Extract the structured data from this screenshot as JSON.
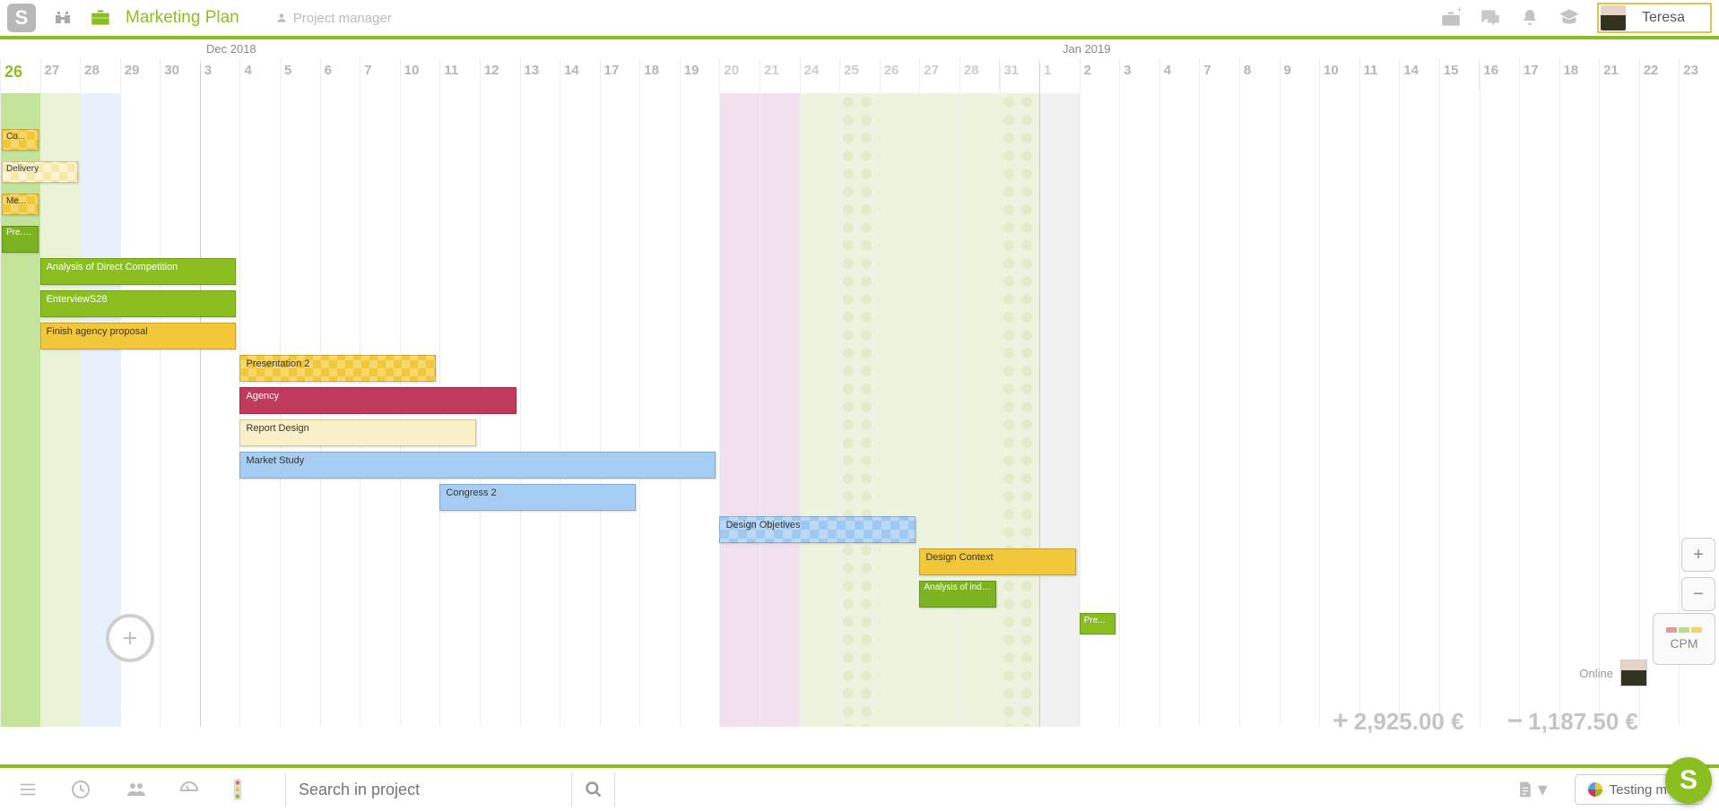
{
  "header": {
    "title": "Marketing Plan",
    "role": "Project manager",
    "user_name": "Teresa"
  },
  "timeline": {
    "month_left": "Dec 2018",
    "month_right": "Jan 2019",
    "days": [
      "26",
      "27",
      "28",
      "29",
      "30",
      "3",
      "4",
      "5",
      "6",
      "7",
      "10",
      "11",
      "12",
      "13",
      "14",
      "17",
      "18",
      "19",
      "20",
      "21",
      "24",
      "25",
      "26",
      "27",
      "28",
      "31",
      "1",
      "2",
      "3",
      "4",
      "7",
      "8",
      "9",
      "10",
      "11",
      "14",
      "15",
      "16",
      "17",
      "18",
      "21",
      "22",
      "23"
    ]
  },
  "tasks": [
    {
      "label": "Co...",
      "row": 0,
      "start": 0,
      "span": 1,
      "cls": "c-yellow-chk small"
    },
    {
      "label": "Delivery",
      "row": 1,
      "start": 0,
      "span": 2,
      "cls": "c-yellow-chk-l small"
    },
    {
      "label": "Me...",
      "row": 2,
      "start": 0,
      "span": 1,
      "cls": "c-yellow-chk small"
    },
    {
      "label": "Pre... for the",
      "row": 3,
      "start": 0,
      "span": 1,
      "cls": "c-green-d multi"
    },
    {
      "label": "Analysis of Direct Competition",
      "row": 4,
      "start": 1,
      "span": 5,
      "cls": "c-green"
    },
    {
      "label": "EnterviewS28",
      "row": 5,
      "start": 1,
      "span": 5,
      "cls": "c-green"
    },
    {
      "label": "Finish agency proposal",
      "row": 6,
      "start": 1,
      "span": 5,
      "cls": "c-yellow"
    },
    {
      "label": "Presentation 2",
      "row": 7,
      "start": 6,
      "span": 5,
      "cls": "c-yellow-chk"
    },
    {
      "label": "Agency",
      "row": 8,
      "start": 6,
      "span": 7,
      "cls": "c-crimson"
    },
    {
      "label": "Report Design",
      "row": 9,
      "start": 6,
      "span": 6,
      "cls": "c-cream"
    },
    {
      "label": "Market Study",
      "row": 10,
      "start": 6,
      "span": 12,
      "cls": "c-blue"
    },
    {
      "label": "Congress 2",
      "row": 11,
      "start": 11,
      "span": 5,
      "cls": "c-blue"
    },
    {
      "label": "Design Objetives",
      "row": 12,
      "start": 18,
      "span": 5,
      "cls": "c-blue-chk"
    },
    {
      "label": "Design Context",
      "row": 13,
      "start": 23,
      "span": 4,
      "cls": "c-yellow"
    },
    {
      "label": "Analysis of indirect competition",
      "row": 14,
      "start": 23,
      "span": 2,
      "cls": "c-green-d multi"
    },
    {
      "label": "Pre...",
      "row": 15,
      "start": 27,
      "span": 1,
      "cls": "c-green-sm small"
    }
  ],
  "totals": {
    "positive": "2,925.00 €",
    "negative": "1,187.50 €"
  },
  "sidebar": {
    "cpm": "CPM",
    "online": "Online"
  },
  "bottom": {
    "search_placeholder": "Search in project",
    "testing_label": "Testing mode"
  },
  "colors": {
    "accent": "#8bbf1f"
  }
}
